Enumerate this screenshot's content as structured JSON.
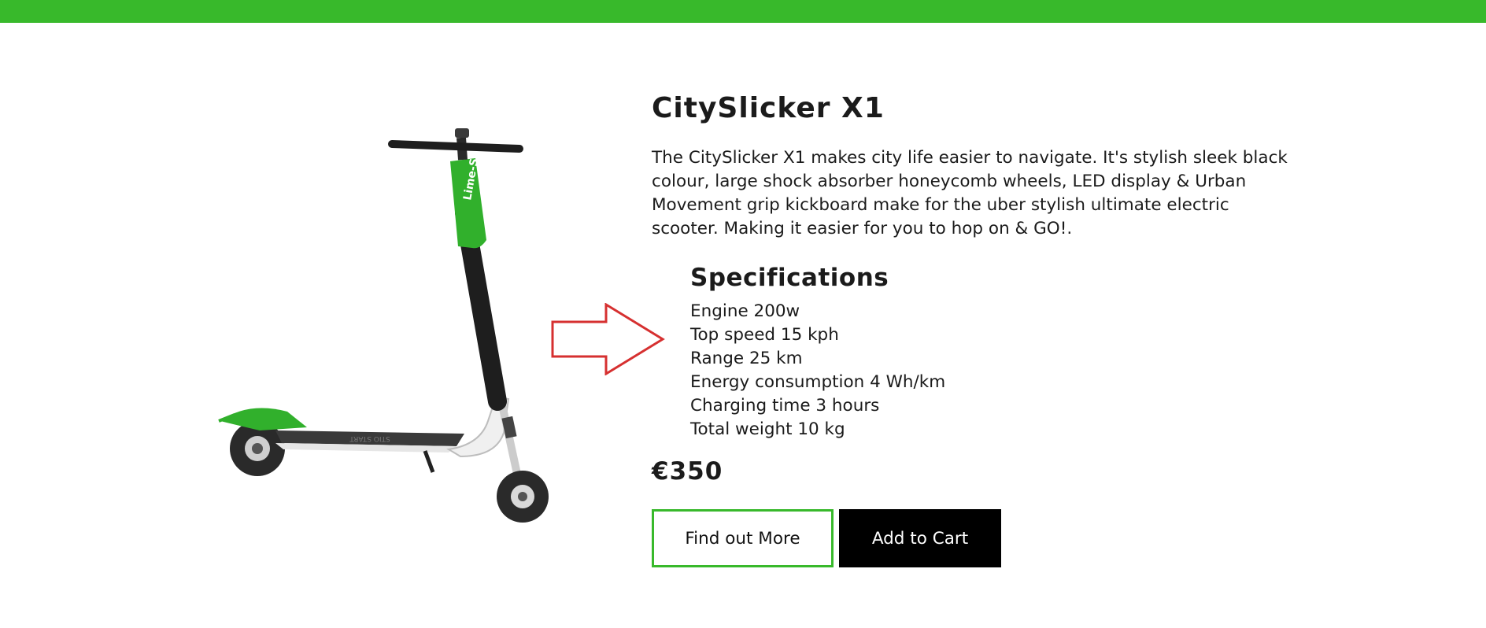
{
  "colors": {
    "accent": "#38b92b",
    "text": "#1b1b1b",
    "cart_button": "#000000",
    "arrow": "#d63030"
  },
  "scooter": {
    "brand_label": "Lime-S"
  },
  "product": {
    "title": "CitySlicker X1",
    "description": "The CitySlicker X1 makes city life easier to navigate. It's stylish sleek black colour, large shock absorber honeycomb wheels, LED display & Urban Movement grip kickboard make for the uber stylish ultimate electric scooter. Making it easier for you to hop on & GO!.",
    "specs_title": "Specifications",
    "specs": [
      "Engine 200w",
      "Top speed 15 kph",
      "Range 25 km",
      "Energy consumption 4 Wh/km",
      "Charging time 3 hours",
      "Total weight 10 kg"
    ],
    "price": "€350"
  },
  "buttons": {
    "find_out_more": "Find out More",
    "add_to_cart": "Add to Cart"
  },
  "icons": {
    "arrow": "right-arrow-icon"
  }
}
